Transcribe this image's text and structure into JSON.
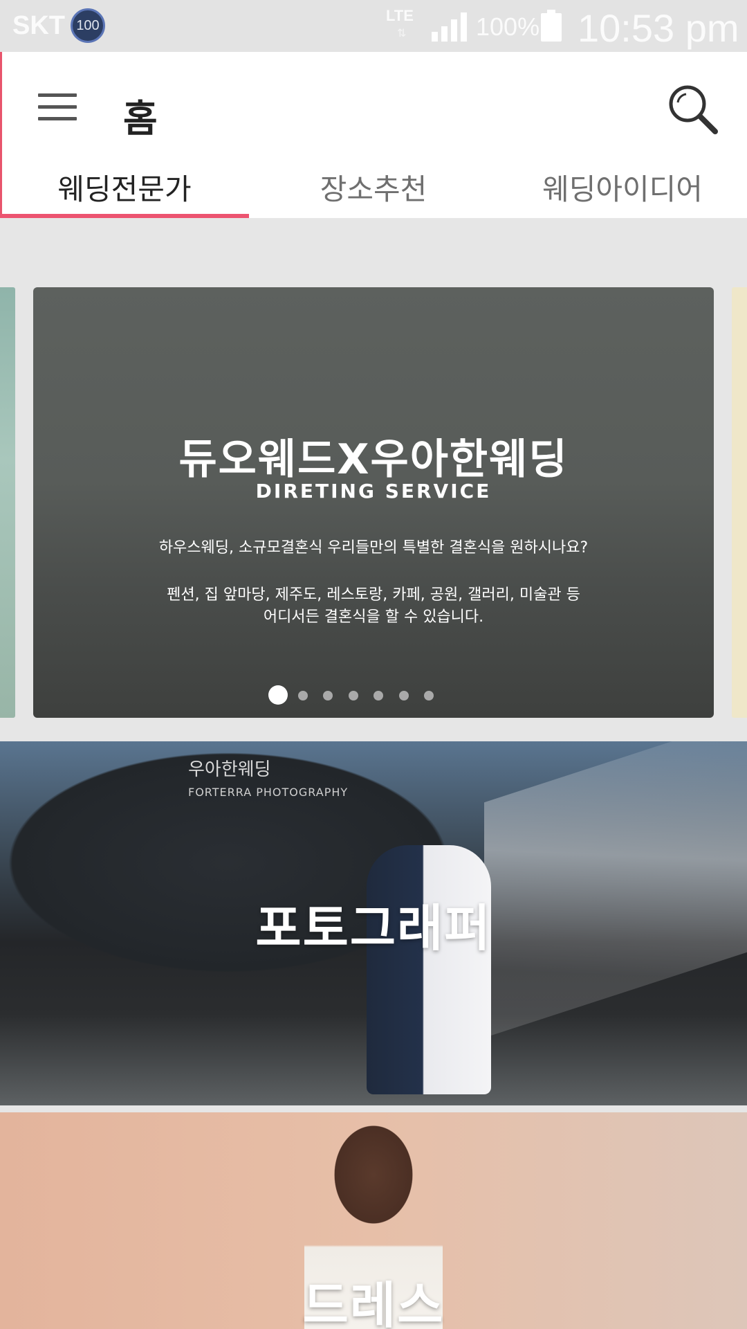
{
  "status_bar": {
    "carrier": "SKT",
    "notification_badge": "100",
    "network": "LTE",
    "battery_percent": "100%",
    "time": "10:53 pm"
  },
  "app_bar": {
    "title": "홈",
    "menu_icon": "hamburger-menu-icon",
    "search_icon": "search-icon"
  },
  "tabs": [
    {
      "label": "웨딩전문가",
      "active": true
    },
    {
      "label": "장소추천",
      "active": false
    },
    {
      "label": "웨딩아이디어",
      "active": false
    }
  ],
  "banner": {
    "headline": "듀오웨드X우아한웨딩",
    "subtitle": "DIRETING SERVICE",
    "line1": "하우스웨딩, 소규모결혼식 우리들만의 특별한 결혼식을 원하시나요?",
    "line2": "펜션, 집 앞마당, 제주도, 레스토랑, 카페, 공원, 갤러리, 미술관 등",
    "line3": "어디서든 결혼식을 할 수 있습니다.",
    "page_count": 7,
    "active_page": 1
  },
  "cards": {
    "photographer": {
      "label": "포토그래퍼",
      "watermark_logo": "우아한웨딩",
      "watermark_sub": "FORTERRA PHOTOGRAPHY"
    },
    "dress": {
      "label": "드레스"
    }
  },
  "colors": {
    "accent": "#ec5470",
    "status_bar_bg": "#e3e3e3",
    "app_bar_bg": "#ffffff"
  }
}
